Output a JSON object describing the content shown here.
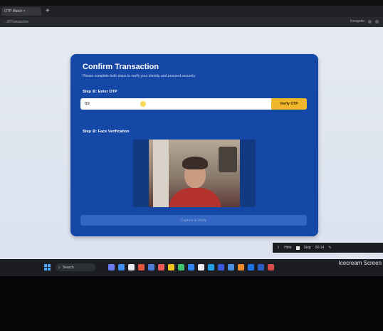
{
  "browser": {
    "tab_title": "OTP Match ×",
    "new_tab": "+",
    "url": "...8/Transaction",
    "addr_right_label": "Incognito"
  },
  "page": {
    "title": "Confirm Transaction",
    "subtitle": "Please complete both steps to verify your identity and proceed securely.",
    "step1_label": "Step ①: Enter OTP",
    "otp_value": "69",
    "verify_label": "Verify OTP",
    "step2_label": "Step ②: Face Verification",
    "capture_label": "Capture & Verify"
  },
  "recorder": {
    "stop_label": "Stop",
    "time": "00:14",
    "hide_label": "Hide"
  },
  "watermark": {
    "line1": "Recorded in FREE",
    "line2": "Icecream Screen"
  },
  "taskbar": {
    "search_label": "Search"
  },
  "colors": {
    "card": "#1447a6",
    "accent_button": "#f0b72a",
    "capture_button": "#3466c4"
  }
}
